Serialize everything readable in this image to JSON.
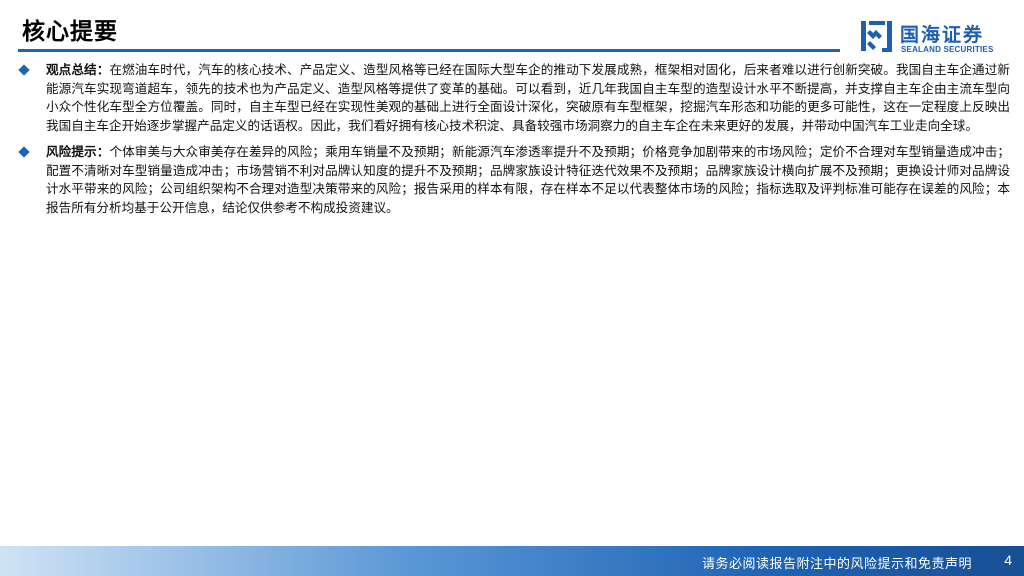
{
  "header": {
    "title": "核心提要"
  },
  "logo": {
    "cn_name": "国海证券",
    "en_name": "SEALAND SECURITIES",
    "color": "#1d5fb0"
  },
  "bullets": [
    {
      "label": "观点总结：",
      "text": "在燃油车时代，汽车的核心技术、产品定义、造型风格等已经在国际大型车企的推动下发展成熟，框架相对固化，后来者难以进行创新突破。我国自主车企通过新能源汽车实现弯道超车，领先的技术也为产品定义、造型风格等提供了变革的基础。可以看到，近几年我国自主车型的造型设计水平不断提高，并支撑自主车企由主流车型向小众个性化车型全方位覆盖。同时，自主车型已经在实现性美观的基础上进行全面设计深化，突破原有车型框架，挖掘汽车形态和功能的更多可能性，这在一定程度上反映出我国自主车企开始逐步掌握产品定义的话语权。因此，我们看好拥有核心技术积淀、具备较强市场洞察力的自主车企在未来更好的发展，并带动中国汽车工业走向全球。"
    },
    {
      "label": "风险提示：",
      "text": "个体审美与大众审美存在差异的风险；乘用车销量不及预期；新能源汽车渗透率提升不及预期；价格竞争加剧带来的市场风险；定价不合理对车型销量造成冲击；配置不清晰对车型销量造成冲击；市场营销不利对品牌认知度的提升不及预期；品牌家族设计特征迭代效果不及预期；品牌家族设计横向扩展不及预期；更换设计师对品牌设计水平带来的风险；公司组织架构不合理对造型决策带来的风险；报告采用的样本有限，存在样本不足以代表整体市场的风险；指标选取及评判标准可能存在误差的风险；本报告所有分析均基于公开信息，结论仅供参考不构成投资建议。"
    }
  ],
  "footer": {
    "disclaimer": "请务必阅读报告附注中的风险提示和免责声明",
    "page_number": "4"
  },
  "colors": {
    "accent": "#1e63b4",
    "footer_dark": "#174f94"
  }
}
